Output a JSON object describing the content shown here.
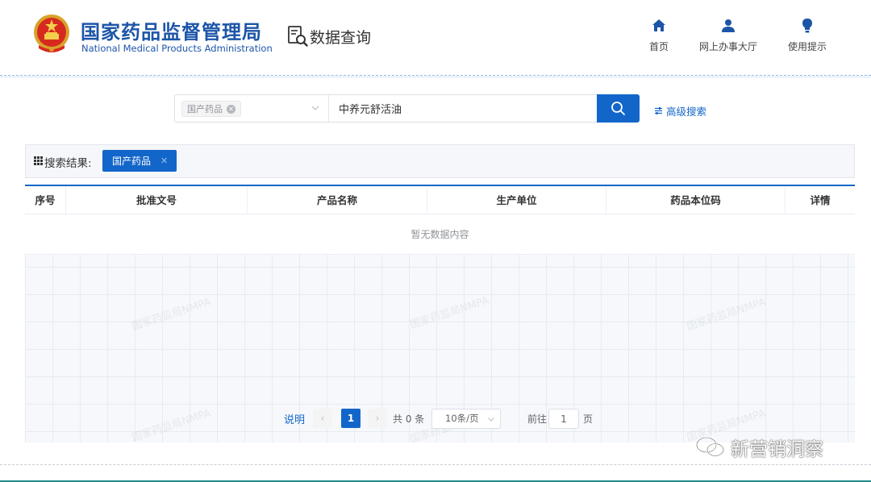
{
  "header": {
    "org_name_cn": "国家药品监督管理局",
    "org_name_en": "National Medical Products Administration",
    "section_title": "数据查询",
    "nav": [
      {
        "label": "首页",
        "icon": "home-icon"
      },
      {
        "label": "网上办事大厅",
        "icon": "user-icon"
      },
      {
        "label": "使用提示",
        "icon": "lightbulb-icon"
      }
    ]
  },
  "search": {
    "category_tag": "国产药品",
    "query": "中养元舒活油",
    "advanced_label": "高级搜索"
  },
  "results": {
    "label": "搜索结果:",
    "filter_chip": "国产药品",
    "columns": [
      "序号",
      "批准文号",
      "产品名称",
      "生产单位",
      "药品本位码",
      "详情"
    ],
    "empty_text": "暂无数据内容",
    "watermark_text": "国家药监局NMPA"
  },
  "pagination": {
    "note_label": "说明",
    "current_page": "1",
    "total_text": "共 0 条",
    "page_size": "10条/页",
    "goto_label": "前往",
    "goto_value": "1",
    "page_suffix": "页"
  },
  "overlay": {
    "account_name": "新营销洞察"
  },
  "colors": {
    "brand_blue": "#1366c9",
    "title_blue": "#1c55a8"
  }
}
